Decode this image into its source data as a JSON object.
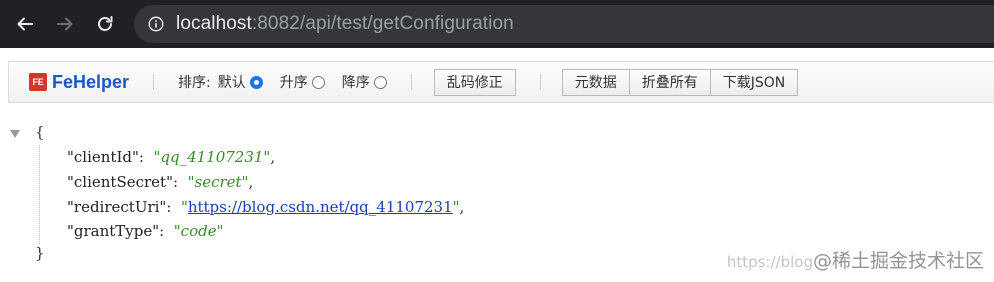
{
  "browser": {
    "url_host": "localhost",
    "url_rest": ":8082/api/test/getConfiguration"
  },
  "toolbar": {
    "logo_mark": "FE",
    "logo_name": "FeHelper",
    "sort_label": "排序:",
    "sort_options": [
      {
        "label": "默认",
        "checked": true
      },
      {
        "label": "升序",
        "checked": false
      },
      {
        "label": "降序",
        "checked": false
      }
    ],
    "fix_encoding_button": "乱码修正",
    "metadata_button": "元数据",
    "collapse_all_button": "折叠所有",
    "download_json_button": "下载JSON"
  },
  "json_view": {
    "open_brace": "{",
    "close_brace": "}",
    "entries": [
      {
        "key": "\"clientId\"",
        "value": "\"qq_41107231\"",
        "is_link": false,
        "trailing": ","
      },
      {
        "key": "\"clientSecret\"",
        "value": "\"secret\"",
        "is_link": false,
        "trailing": ","
      },
      {
        "key": "\"redirectUri\"",
        "value_quote_open": "\"",
        "link_text": "https://blog.csdn.net/qq_41107231",
        "value_quote_close": "\"",
        "is_link": true,
        "trailing": ","
      },
      {
        "key": "\"grantType\"",
        "value": "\"code\"",
        "is_link": false,
        "trailing": ""
      }
    ]
  },
  "watermark": {
    "prefix": "https://blog",
    "brand": "@稀土掘金技术社区"
  },
  "colors": {
    "chrome_bg": "#202124",
    "address_bg": "#35363a",
    "logo_red": "#d9342b",
    "logo_blue": "#1d57c2",
    "string_green": "#3a8a2a",
    "link_blue": "#1a3fb5"
  }
}
